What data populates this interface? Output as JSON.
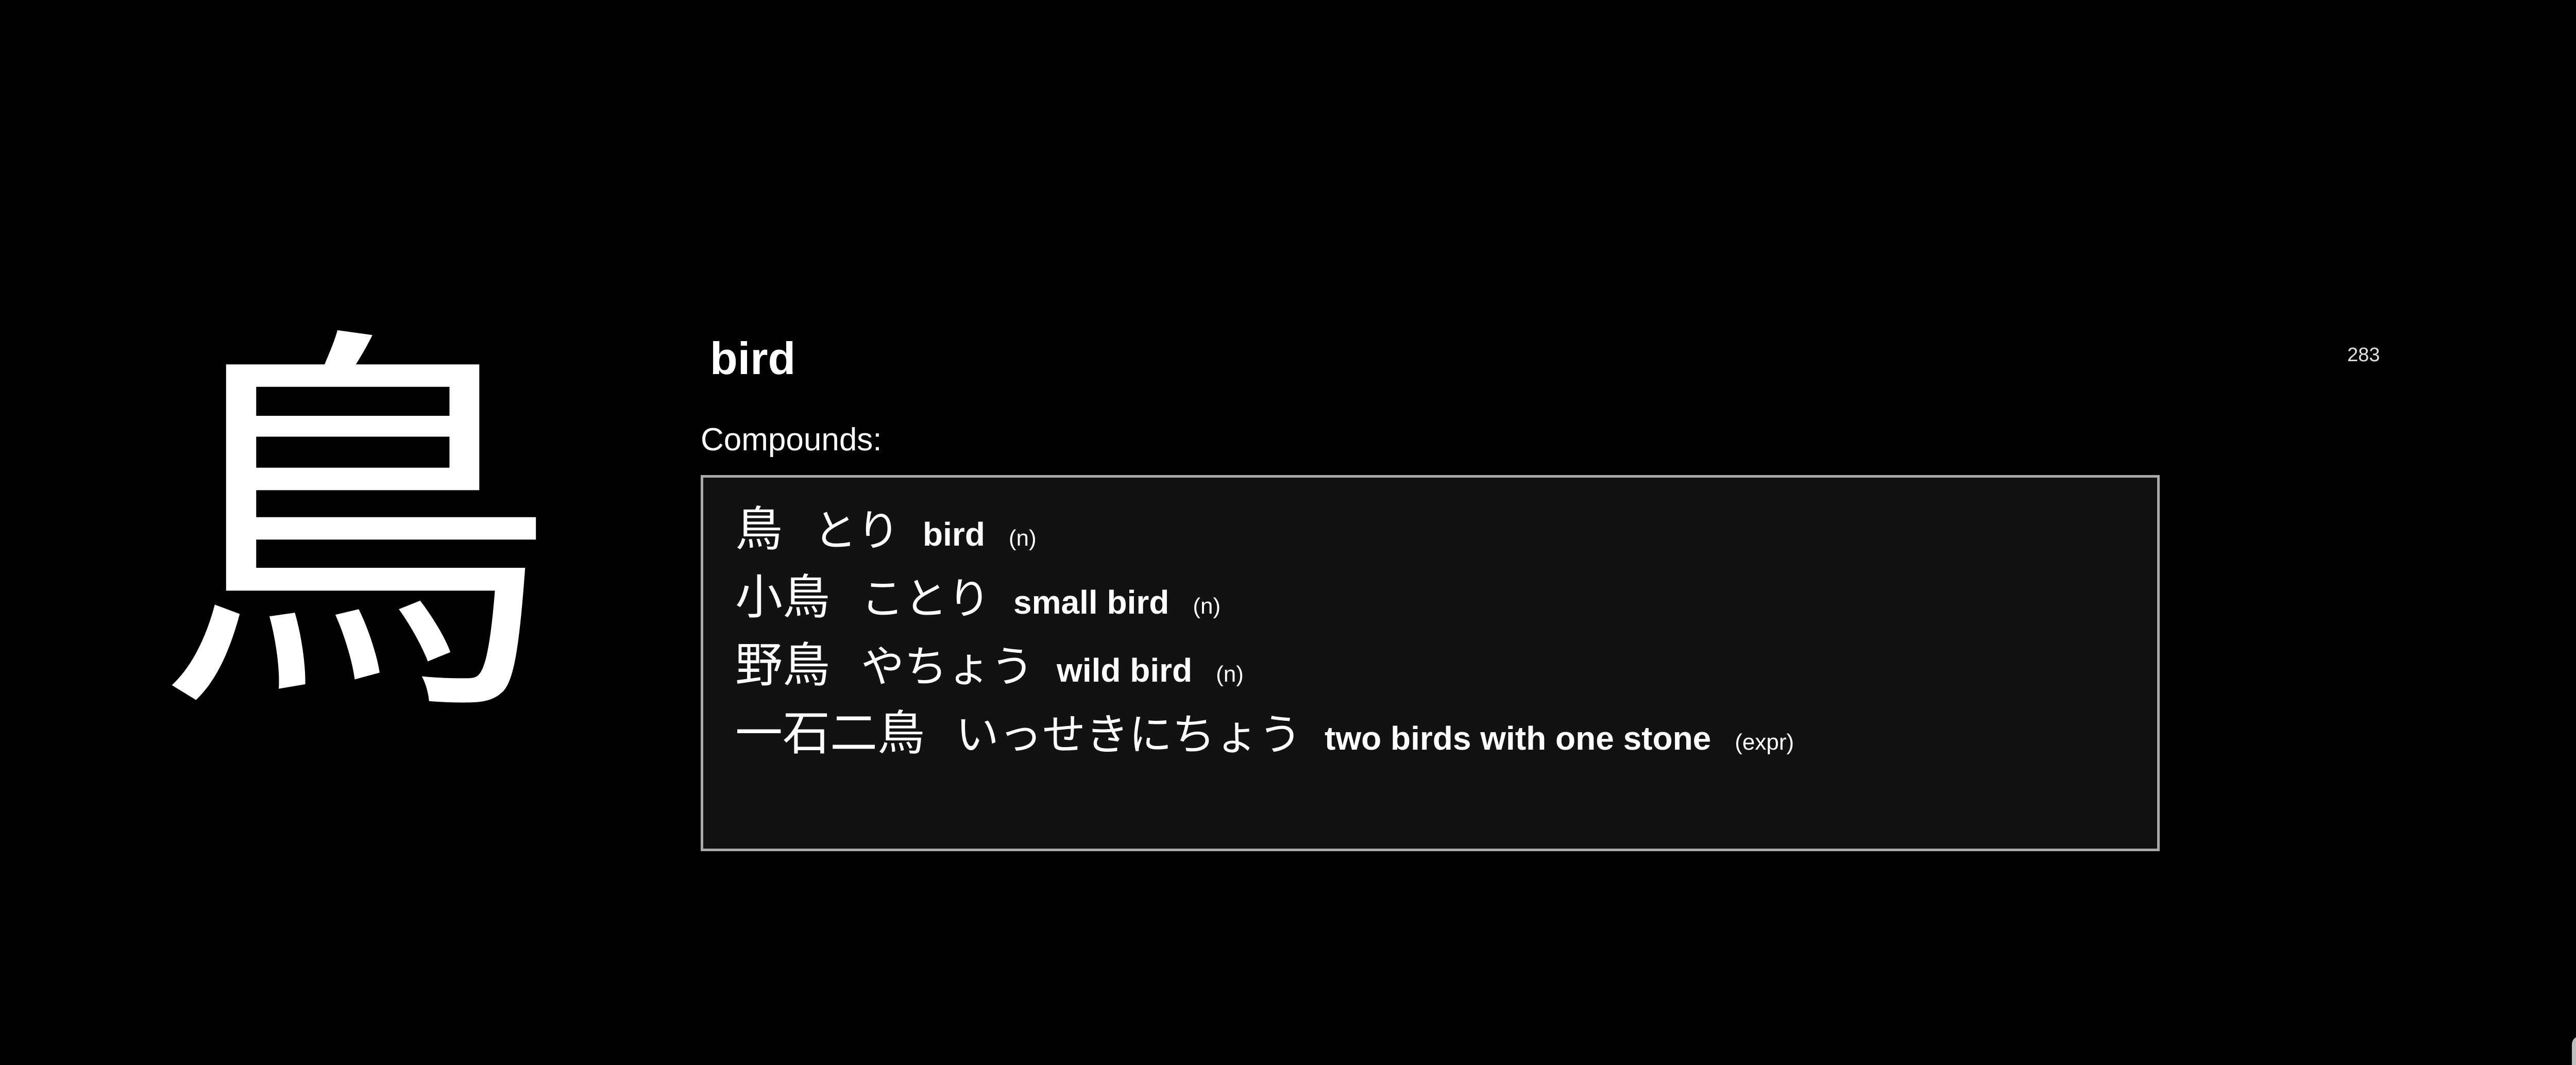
{
  "kanji": "鳥",
  "meaning": "bird",
  "index": "283",
  "compounds_label": "Compounds:",
  "compounds": [
    {
      "kanji": "鳥",
      "reading": "とり",
      "meaning": "bird",
      "pos": "(n)"
    },
    {
      "kanji": "小鳥",
      "reading": "ことり",
      "meaning": "small bird",
      "pos": "(n)"
    },
    {
      "kanji": "野鳥",
      "reading": "やちょう",
      "meaning": "wild bird",
      "pos": "(n)"
    },
    {
      "kanji": "一石二鳥",
      "reading": "いっせきにちょう",
      "meaning": "two birds with one stone",
      "pos": "(expr)"
    }
  ],
  "colors": {
    "background": "#000000",
    "text": "#ffffff",
    "box_background": "#121212",
    "box_border": "#a9a9a9"
  }
}
